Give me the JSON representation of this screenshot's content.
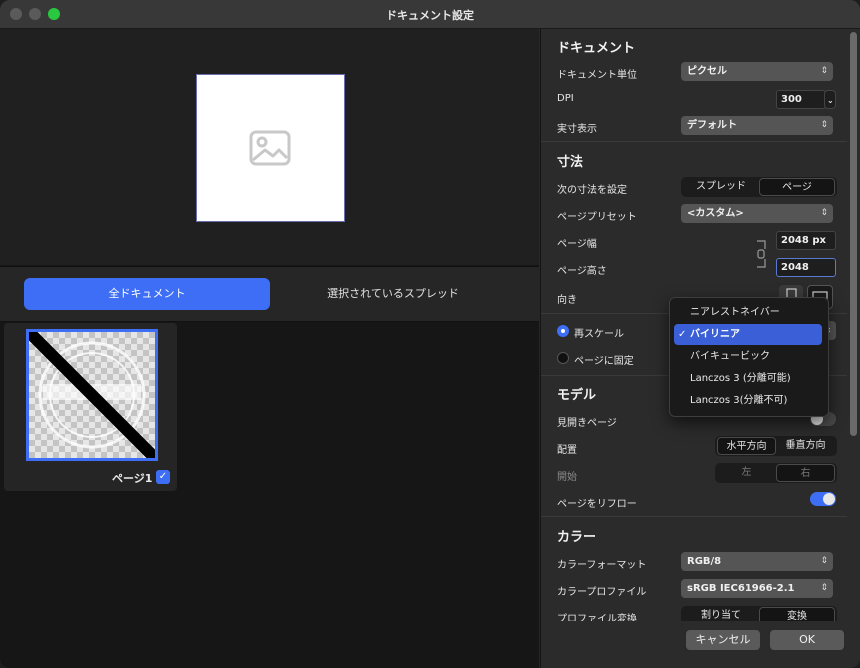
{
  "window": {
    "title": "ドキュメント設定"
  },
  "left": {
    "segments": {
      "all": "全ドキュメント",
      "selected": "選択されているスプレッド"
    },
    "thumbnail": {
      "label": "ページ1",
      "checked": true
    }
  },
  "document": {
    "title": "ドキュメント",
    "unit_label": "ドキュメント単位",
    "unit_value": "ピクセル",
    "dpi_label": "DPI",
    "dpi_value": "300",
    "display_label": "実寸表示",
    "display_value": "デフォルト"
  },
  "dimensions": {
    "title": "寸法",
    "set_label": "次の寸法を設定",
    "set_options": [
      "スプレッド",
      "ページ"
    ],
    "preset_label": "ページプリセット",
    "preset_value": "<カスタム>",
    "width_label": "ページ幅",
    "width_value": "2048 px",
    "height_label": "ページ高さ",
    "height_value": "2048",
    "orientation_label": "向き",
    "rescale_label": "再スケール",
    "fixed_label": "ページに固定"
  },
  "resample_menu": {
    "items": [
      "ニアレストネイバー",
      "バイリニア",
      "バイキュービック",
      "Lanczos 3 (分離可能)",
      "Lanczos 3(分離不可)"
    ],
    "selected": "バイリニア",
    "check": "✓"
  },
  "model": {
    "title": "モデル",
    "facing_label": "見開きページ",
    "arrange_label": "配置",
    "arrange_options": [
      "水平方向",
      "垂直方向"
    ],
    "start_label": "開始",
    "start_options": [
      "左",
      "右"
    ],
    "reflow_label": "ページをリフロー"
  },
  "color": {
    "title": "カラー",
    "format_label": "カラーフォーマット",
    "format_value": "RGB/8",
    "profile_label": "カラープロファイル",
    "profile_value": "sRGB IEC61966-2.1",
    "convert_label": "プロファイル変換",
    "convert_options": [
      "割り当て",
      "変換"
    ]
  },
  "footer": {
    "cancel": "キャンセル",
    "ok": "OK"
  },
  "colors": {
    "accent": "#3d6ef5",
    "menu_selected": "#3a5fd6"
  }
}
